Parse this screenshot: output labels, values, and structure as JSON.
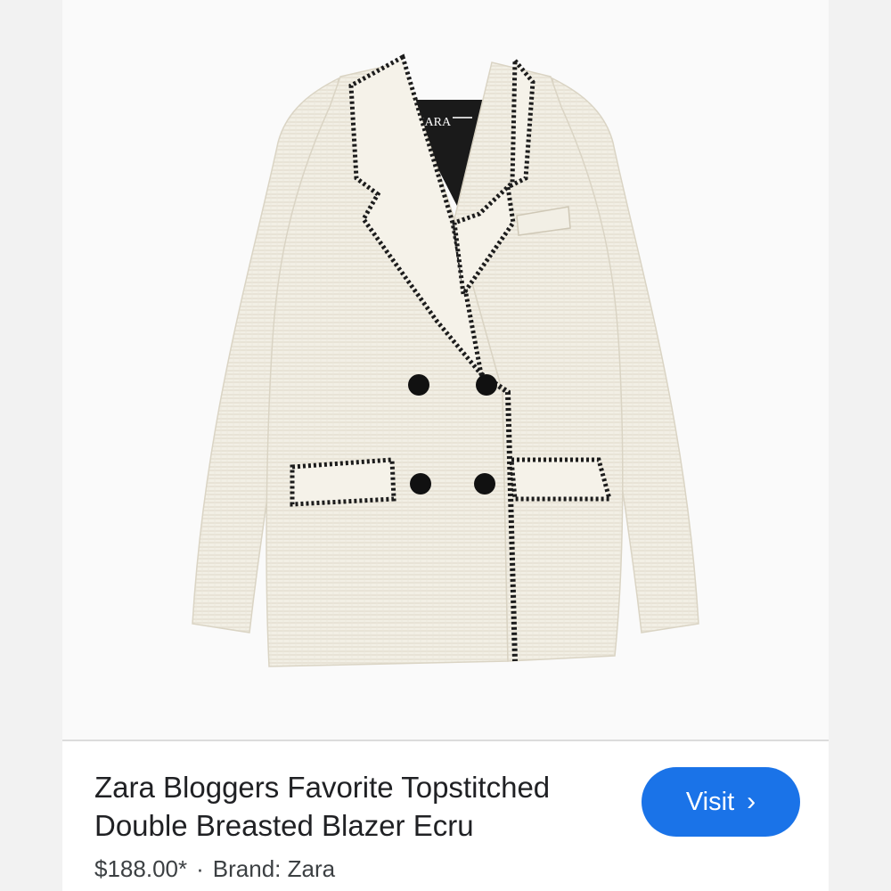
{
  "product": {
    "image_alt": "Double breasted tweed blazer with black topstitched trim",
    "label_brand_text": "ZARA",
    "title": "Zara Bloggers Favorite Topstitched Double Breasted Blazer Ecru",
    "price": "$188.00*",
    "separator": "·",
    "brand": "Brand: Zara"
  },
  "actions": {
    "visit_label": "Visit",
    "visit_icon": "chevron-right-icon"
  },
  "colors": {
    "accent": "#1a73e8",
    "blazer": "#f1eee4",
    "trim": "#1c1c1c"
  }
}
